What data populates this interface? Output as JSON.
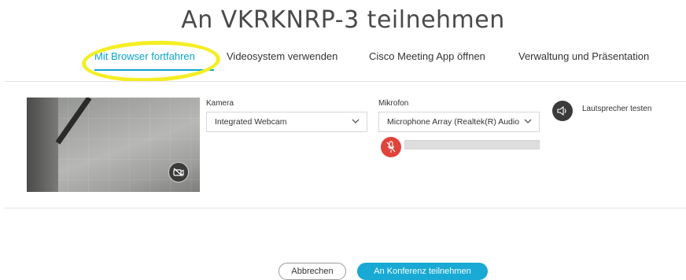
{
  "page": {
    "title": "An VKRKNRP-3 teilnehmen"
  },
  "tabs": [
    {
      "label": "Mit Browser fortfahren",
      "active": true
    },
    {
      "label": "Videosystem verwenden",
      "active": false
    },
    {
      "label": "Cisco Meeting App öffnen",
      "active": false
    },
    {
      "label": "Verwaltung und Präsentation",
      "active": false
    }
  ],
  "camera": {
    "label": "Kamera",
    "selected": "Integrated Webcam",
    "toggle_icon": "camera-off-icon"
  },
  "microphone": {
    "label": "Mikrofon",
    "selected": "Microphone Array (Realtek(R) Audio",
    "mute_icon": "mic-muted-icon",
    "level": 0
  },
  "speaker": {
    "label": "Lautsprecher testen",
    "icon": "speaker-icon"
  },
  "actions": {
    "cancel_label": "Abbrechen",
    "join_label": "An Konferenz teilnehmen"
  },
  "colors": {
    "accent": "#18a9d4",
    "active_tab": "#0aa4cc",
    "mute_red": "#e0433a",
    "highlight": "#f4ee23"
  }
}
